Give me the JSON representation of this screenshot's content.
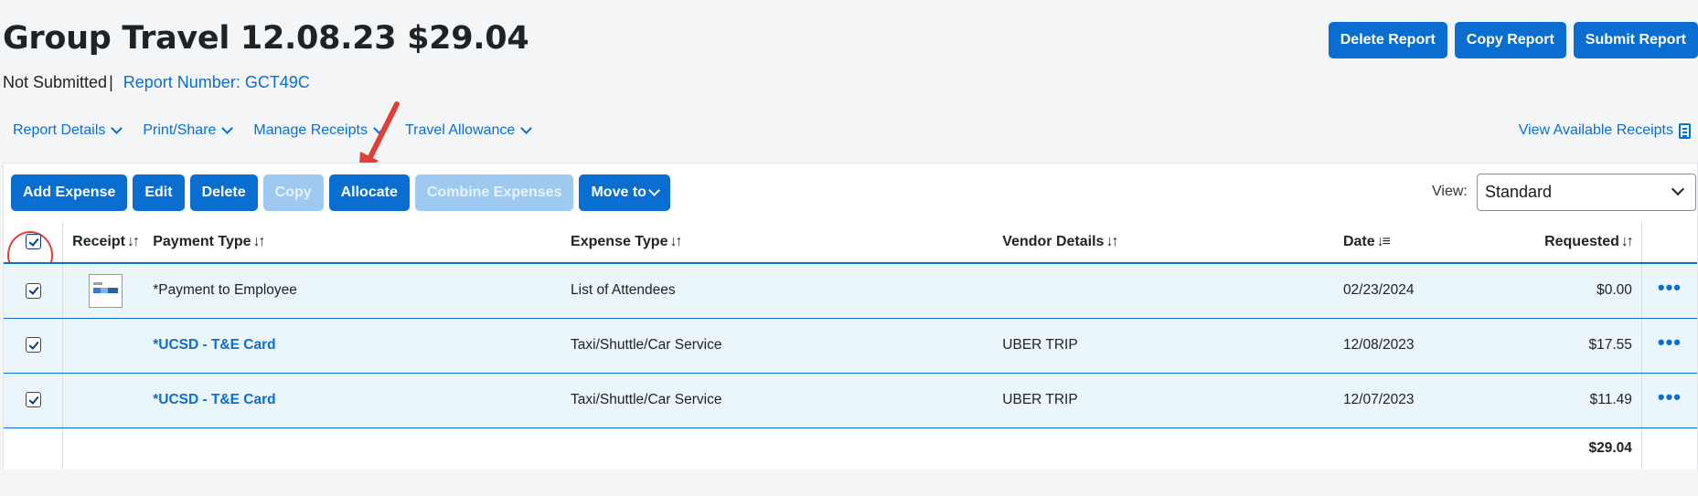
{
  "header": {
    "title": "Group Travel 12.08.23 $29.04",
    "status": "Not Submitted",
    "separator": "|",
    "report_number": "Report Number: GCT49C"
  },
  "top_actions": {
    "delete_report": "Delete Report",
    "copy_report": "Copy Report",
    "submit_report": "Submit Report"
  },
  "menu": {
    "report_details": "Report Details",
    "print_share": "Print/Share",
    "manage_receipts": "Manage Receipts",
    "travel_allowance": "Travel Allowance",
    "view_available_receipts": "View Available Receipts"
  },
  "toolbar": {
    "add_expense": "Add Expense",
    "edit": "Edit",
    "delete": "Delete",
    "copy": "Copy",
    "allocate": "Allocate",
    "combine_expenses": "Combine Expenses",
    "move_to": "Move to"
  },
  "view": {
    "label": "View:",
    "selected": "Standard"
  },
  "table": {
    "columns": {
      "receipt": "Receipt",
      "payment_type": "Payment Type",
      "expense_type": "Expense Type",
      "vendor_details": "Vendor Details",
      "date": "Date",
      "requested": "Requested"
    },
    "sort_icon": "↓↑",
    "date_sort_icon": "↓≡",
    "rows": [
      {
        "payment_type": "*Payment to Employee",
        "expense_type": "List of Attendees",
        "vendor": "",
        "date": "02/23/2024",
        "requested": "$0.00",
        "has_receipt": true
      },
      {
        "payment_type": "*UCSD - T&E Card",
        "expense_type": "Taxi/Shuttle/Car Service",
        "vendor": "UBER TRIP",
        "date": "12/08/2023",
        "requested": "$17.55",
        "has_receipt": false
      },
      {
        "payment_type": "*UCSD - T&E Card",
        "expense_type": "Taxi/Shuttle/Car Service",
        "vendor": "UBER TRIP",
        "date": "12/07/2023",
        "requested": "$11.49",
        "has_receipt": false
      }
    ],
    "more_label": "•••",
    "total": "$29.04"
  },
  "colors": {
    "accent": "#0a6ed1",
    "annotation": "#e0403a",
    "selected_row": "#eaf5fc"
  }
}
